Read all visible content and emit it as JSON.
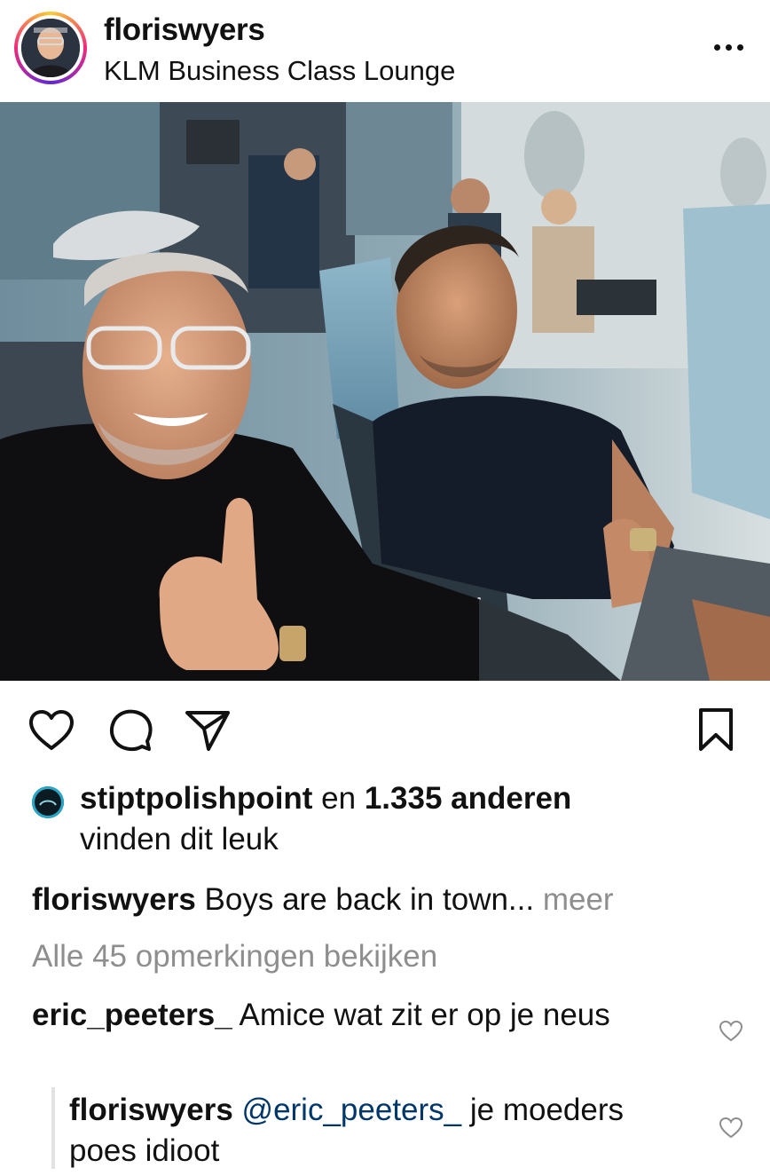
{
  "post": {
    "username": "floriswyers",
    "location": "KLM Business Class Lounge",
    "more_icon": "more-horizontal-icon"
  },
  "photo": {
    "alt_scene": "selfie-in-aircraft-cabin"
  },
  "actions": {
    "icons": [
      "heart-icon",
      "comment-icon",
      "share-icon",
      "bookmark-icon"
    ]
  },
  "likes": {
    "liker": "stiptpolishpoint",
    "connector": " en ",
    "count_text": "1.335 anderen",
    "suffix": "vinden dit leuk"
  },
  "caption": {
    "username": "floriswyers",
    "text": " Boys are back in town... ",
    "more": "meer"
  },
  "view_comments": "Alle 45 opmerkingen bekijken",
  "comments": [
    {
      "username": "eric_peeters_",
      "text": " Amice wat zit er op je neus"
    }
  ],
  "reply": {
    "username": "floriswyers",
    "mention": " @eric_peeters_",
    "text": " je moeders poes idioot"
  },
  "colors": {
    "link_gray": "#8e8e8e",
    "mention_blue": "#00376b",
    "cabin_blue": "#5b7484"
  }
}
